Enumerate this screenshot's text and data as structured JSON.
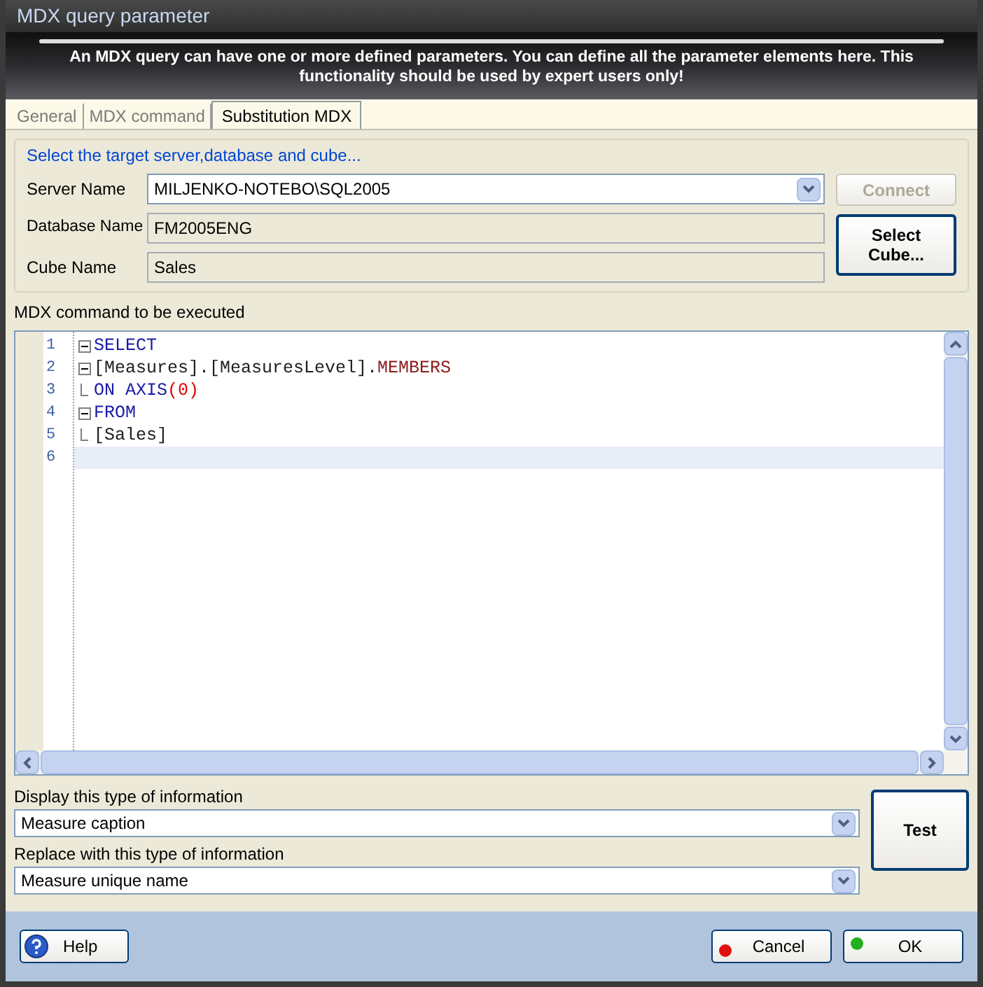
{
  "window": {
    "title": "MDX query parameter"
  },
  "banner": "An MDX query can have one or more defined parameters. You can define all the parameter elements here. This functionality should be used by expert users only!",
  "tabs": [
    {
      "label": "General",
      "selected": false
    },
    {
      "label": "MDX command",
      "selected": false
    },
    {
      "label": "Substitution MDX",
      "selected": true
    }
  ],
  "target_group": {
    "title": "Select the target server,database and cube...",
    "server": {
      "label": "Server Name",
      "value": "MILJENKO-NOTEBO\\SQL2005"
    },
    "database": {
      "label": "Database Name",
      "value": "FM2005ENG"
    },
    "cube": {
      "label": "Cube Name",
      "value": "Sales"
    },
    "connect_button": {
      "label": "Connect",
      "disabled": true
    },
    "select_cube_button": {
      "label": "Select Cube...",
      "disabled": false
    }
  },
  "editor": {
    "label": "MDX command to be executed",
    "lines": [
      {
        "number": "1",
        "collapsible": true,
        "branch_end": false,
        "current": false,
        "tokens": [
          {
            "kind": "keyword",
            "text": "SELECT"
          }
        ]
      },
      {
        "number": "2",
        "collapsible": true,
        "branch_end": false,
        "current": false,
        "tokens": [
          {
            "kind": "plain",
            "text": "[Measures].[MeasuresLevel]."
          },
          {
            "kind": "function",
            "text": "MEMBERS"
          }
        ]
      },
      {
        "number": "3",
        "collapsible": false,
        "branch_end": true,
        "current": false,
        "tokens": [
          {
            "kind": "keyword",
            "text": "ON AXIS"
          },
          {
            "kind": "paren",
            "text": "(0)"
          }
        ]
      },
      {
        "number": "4",
        "collapsible": true,
        "branch_end": false,
        "current": false,
        "tokens": [
          {
            "kind": "keyword",
            "text": "FROM"
          }
        ]
      },
      {
        "number": "5",
        "collapsible": false,
        "branch_end": true,
        "current": false,
        "tokens": [
          {
            "kind": "plain",
            "text": "[Sales]"
          }
        ]
      },
      {
        "number": "6",
        "collapsible": false,
        "branch_end": false,
        "current": true
      }
    ]
  },
  "display": {
    "label": "Display this type of information",
    "value": "Measure caption"
  },
  "replace": {
    "label": "Replace with this type of information",
    "value": "Measure unique name"
  },
  "test_button": "Test",
  "footer": {
    "help": "Help",
    "cancel": "Cancel",
    "ok": "OK"
  }
}
